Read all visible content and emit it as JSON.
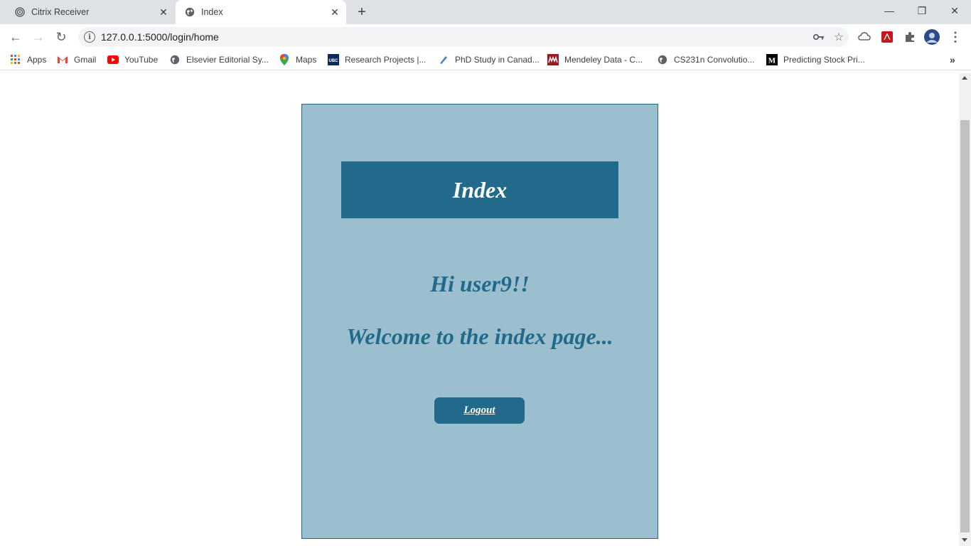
{
  "tabs": [
    {
      "title": "Citrix Receiver",
      "icon": "citrix-icon"
    },
    {
      "title": "Index",
      "icon": "globe-icon"
    }
  ],
  "toolbar": {
    "url": "127.0.0.1:5000/login/home"
  },
  "bookmarks": [
    {
      "label": "Apps",
      "icon": "apps-grid-icon"
    },
    {
      "label": "Gmail",
      "icon": "gmail-icon"
    },
    {
      "label": "YouTube",
      "icon": "youtube-icon"
    },
    {
      "label": "Elsevier Editorial Sy...",
      "icon": "globe-icon"
    },
    {
      "label": "Maps",
      "icon": "maps-pin-icon"
    },
    {
      "label": "Research Projects |...",
      "icon": "ubc-icon"
    },
    {
      "label": "PhD Study in Canad...",
      "icon": "pen-icon"
    },
    {
      "label": "Mendeley Data - C...",
      "icon": "mendeley-icon"
    },
    {
      "label": "CS231n Convolutio...",
      "icon": "globe-icon"
    },
    {
      "label": "Predicting Stock Pri...",
      "icon": "medium-icon"
    }
  ],
  "page": {
    "header": "Index",
    "greeting": "Hi user9!!",
    "welcome": "Welcome to the index page...",
    "logout_label": "Logout"
  },
  "colors": {
    "card_bg": "#9bbfce",
    "accent": "#216a8c",
    "tabstrip": "#dee1e6"
  }
}
